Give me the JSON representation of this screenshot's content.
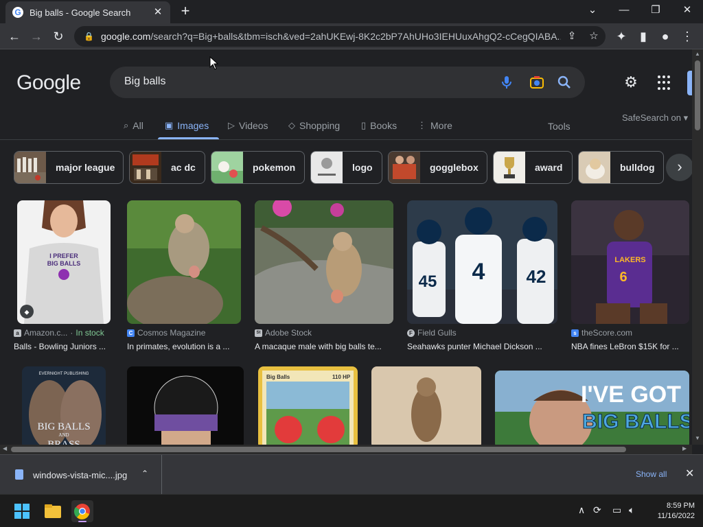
{
  "browser": {
    "tab_title": "Big balls - Google Search",
    "url_host": "google.com",
    "url_rest": "/search?q=Big+balls&tbm=isch&ved=2ahUKEwj-8K2c2bP7AhUHo3IEHUuxAhgQ2-cCegQIABA..."
  },
  "search": {
    "logo": "Google",
    "query": "Big balls"
  },
  "nav": {
    "tabs": [
      {
        "icon": "search-icon",
        "label": "All"
      },
      {
        "icon": "image-icon",
        "label": "Images"
      },
      {
        "icon": "video-icon",
        "label": "Videos"
      },
      {
        "icon": "tag-icon",
        "label": "Shopping"
      },
      {
        "icon": "book-icon",
        "label": "Books"
      },
      {
        "icon": "kebab-icon",
        "label": "More"
      }
    ],
    "active": "Images",
    "tools": "Tools",
    "safesearch": "SafeSearch on"
  },
  "chips": [
    "major league",
    "ac dc",
    "pokemon",
    "logo",
    "gogglebox",
    "award",
    "bulldog"
  ],
  "results": [
    {
      "source": "Amazon.c...",
      "badge": "In stock",
      "caption": "Balls - Bowling Juniors ...",
      "favicon": "a"
    },
    {
      "source": "Cosmos Magazine",
      "caption": "In primates, evolution is a ...",
      "favicon": "C"
    },
    {
      "source": "Adobe Stock",
      "caption": "A macaque male with big balls te...",
      "favicon": "St"
    },
    {
      "source": "Field Gulls",
      "caption": "Seahawks punter Michael Dickson ...",
      "favicon": "F"
    },
    {
      "source": "theScore.com",
      "caption": "NBA fines LeBron $15K for ...",
      "favicon": "s"
    }
  ],
  "image_text": {
    "shirt": [
      "I PREFER",
      "BIG BALLS"
    ],
    "book": [
      "EVERNIGHT PUBLISHING",
      "BIG BALLS",
      "AND",
      "BRASS"
    ],
    "card": [
      "Big Balls",
      "110 HP"
    ],
    "thumb": [
      "I'VE GOT",
      "BIG BALLS"
    ],
    "jerseys": [
      "4",
      "42",
      "45",
      "6"
    ]
  },
  "downloads": {
    "filename": "windows-vista-mic....jpg",
    "show_all": "Show all"
  },
  "taskbar": {
    "time": "8:59 PM",
    "date": "11/16/2022"
  }
}
